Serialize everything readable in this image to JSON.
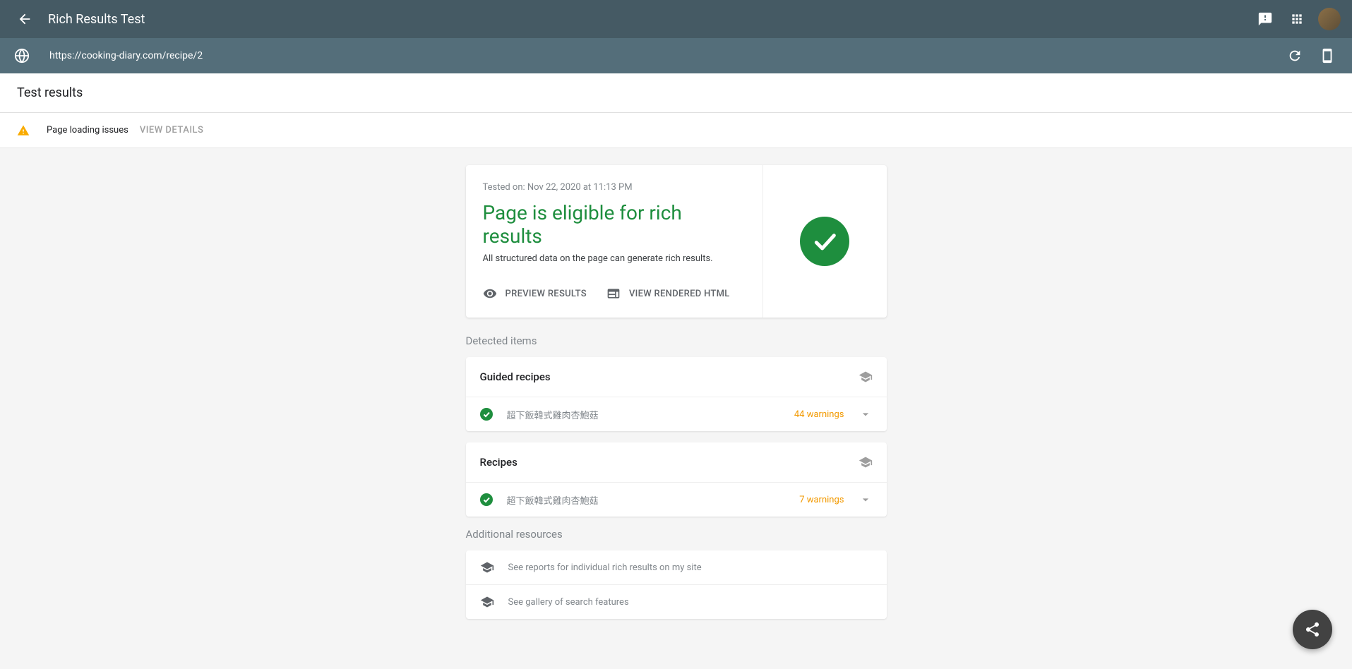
{
  "header": {
    "title": "Rich Results Test"
  },
  "urlBar": {
    "url": "https://cooking-diary.com/recipe/2"
  },
  "subHeader": {
    "title": "Test results"
  },
  "warningBar": {
    "text": "Page loading issues",
    "viewDetails": "VIEW DETAILS"
  },
  "resultCard": {
    "testedOn": "Tested on: Nov 22, 2020 at 11:13 PM",
    "title": "Page is eligible for rich results",
    "subtitle": "All structured data on the page can generate rich results.",
    "previewResults": "PREVIEW RESULTS",
    "viewRenderedHtml": "VIEW RENDERED HTML"
  },
  "detectedItemsLabel": "Detected items",
  "detected": [
    {
      "title": "Guided recipes",
      "itemName": "超下飯韓式雞肉杏鮑菇",
      "warnings": "44 warnings"
    },
    {
      "title": "Recipes",
      "itemName": "超下飯韓式雞肉杏鮑菇",
      "warnings": "7 warnings"
    }
  ],
  "additionalResourcesLabel": "Additional resources",
  "resources": [
    {
      "text": "See reports for individual rich results on my site"
    },
    {
      "text": "See gallery of search features"
    }
  ]
}
